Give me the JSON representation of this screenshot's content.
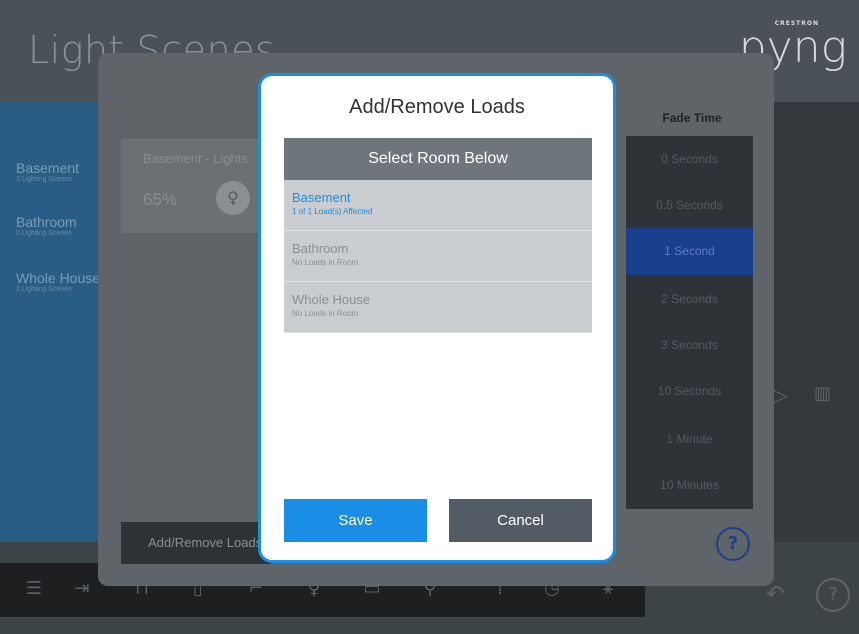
{
  "app": {
    "title": "Light Scenes",
    "logo_small": "CRESTRON",
    "logo": "pyng"
  },
  "sidebar": {
    "items": [
      {
        "name": "Basement",
        "sub": "2 Lighting Scenes"
      },
      {
        "name": "Bathroom",
        "sub": "0 Lighting Scenes"
      },
      {
        "name": "Whole House",
        "sub": "2 Lighting Scenes"
      }
    ]
  },
  "scene_card": {
    "title": "Basement - Lights",
    "level": "65%"
  },
  "fade": {
    "header": "Fade Time",
    "options": [
      "0 Seconds",
      "0.5 Seconds",
      "1 Second",
      "2 Seconds",
      "3 Seconds",
      "10 Seconds",
      "1 Minute",
      "10 Minutes"
    ],
    "selected": "1 Second"
  },
  "panel": {
    "add_remove_label": "Add/Remove Loads",
    "help_glyph": "?"
  },
  "dialog": {
    "title": "Add/Remove Loads",
    "header": "Select Room Below",
    "rooms": [
      {
        "name": "Basement",
        "sub": "1 of 1 Load(s) Affected",
        "active": true
      },
      {
        "name": "Bathroom",
        "sub": "No Loads in Room",
        "active": false
      },
      {
        "name": "Whole House",
        "sub": "No Loads in Room",
        "active": false
      }
    ],
    "save_label": "Save",
    "cancel_label": "Cancel"
  },
  "colors": {
    "accent": "#1a8ee6",
    "selected_fade": "#1a3f8f",
    "cancel": "#535c64"
  },
  "icons": [
    "menu-icon",
    "exit-icon",
    "sofa-icon",
    "door-icon",
    "shades-icon",
    "light-bulb-icon",
    "book-icon",
    "thermometer-icon",
    "keypad-icon",
    "clock-icon",
    "temperature-settings-icon",
    "back-arrow-icon",
    "help-icon",
    "trash-icon",
    "chevron-right-icon"
  ]
}
